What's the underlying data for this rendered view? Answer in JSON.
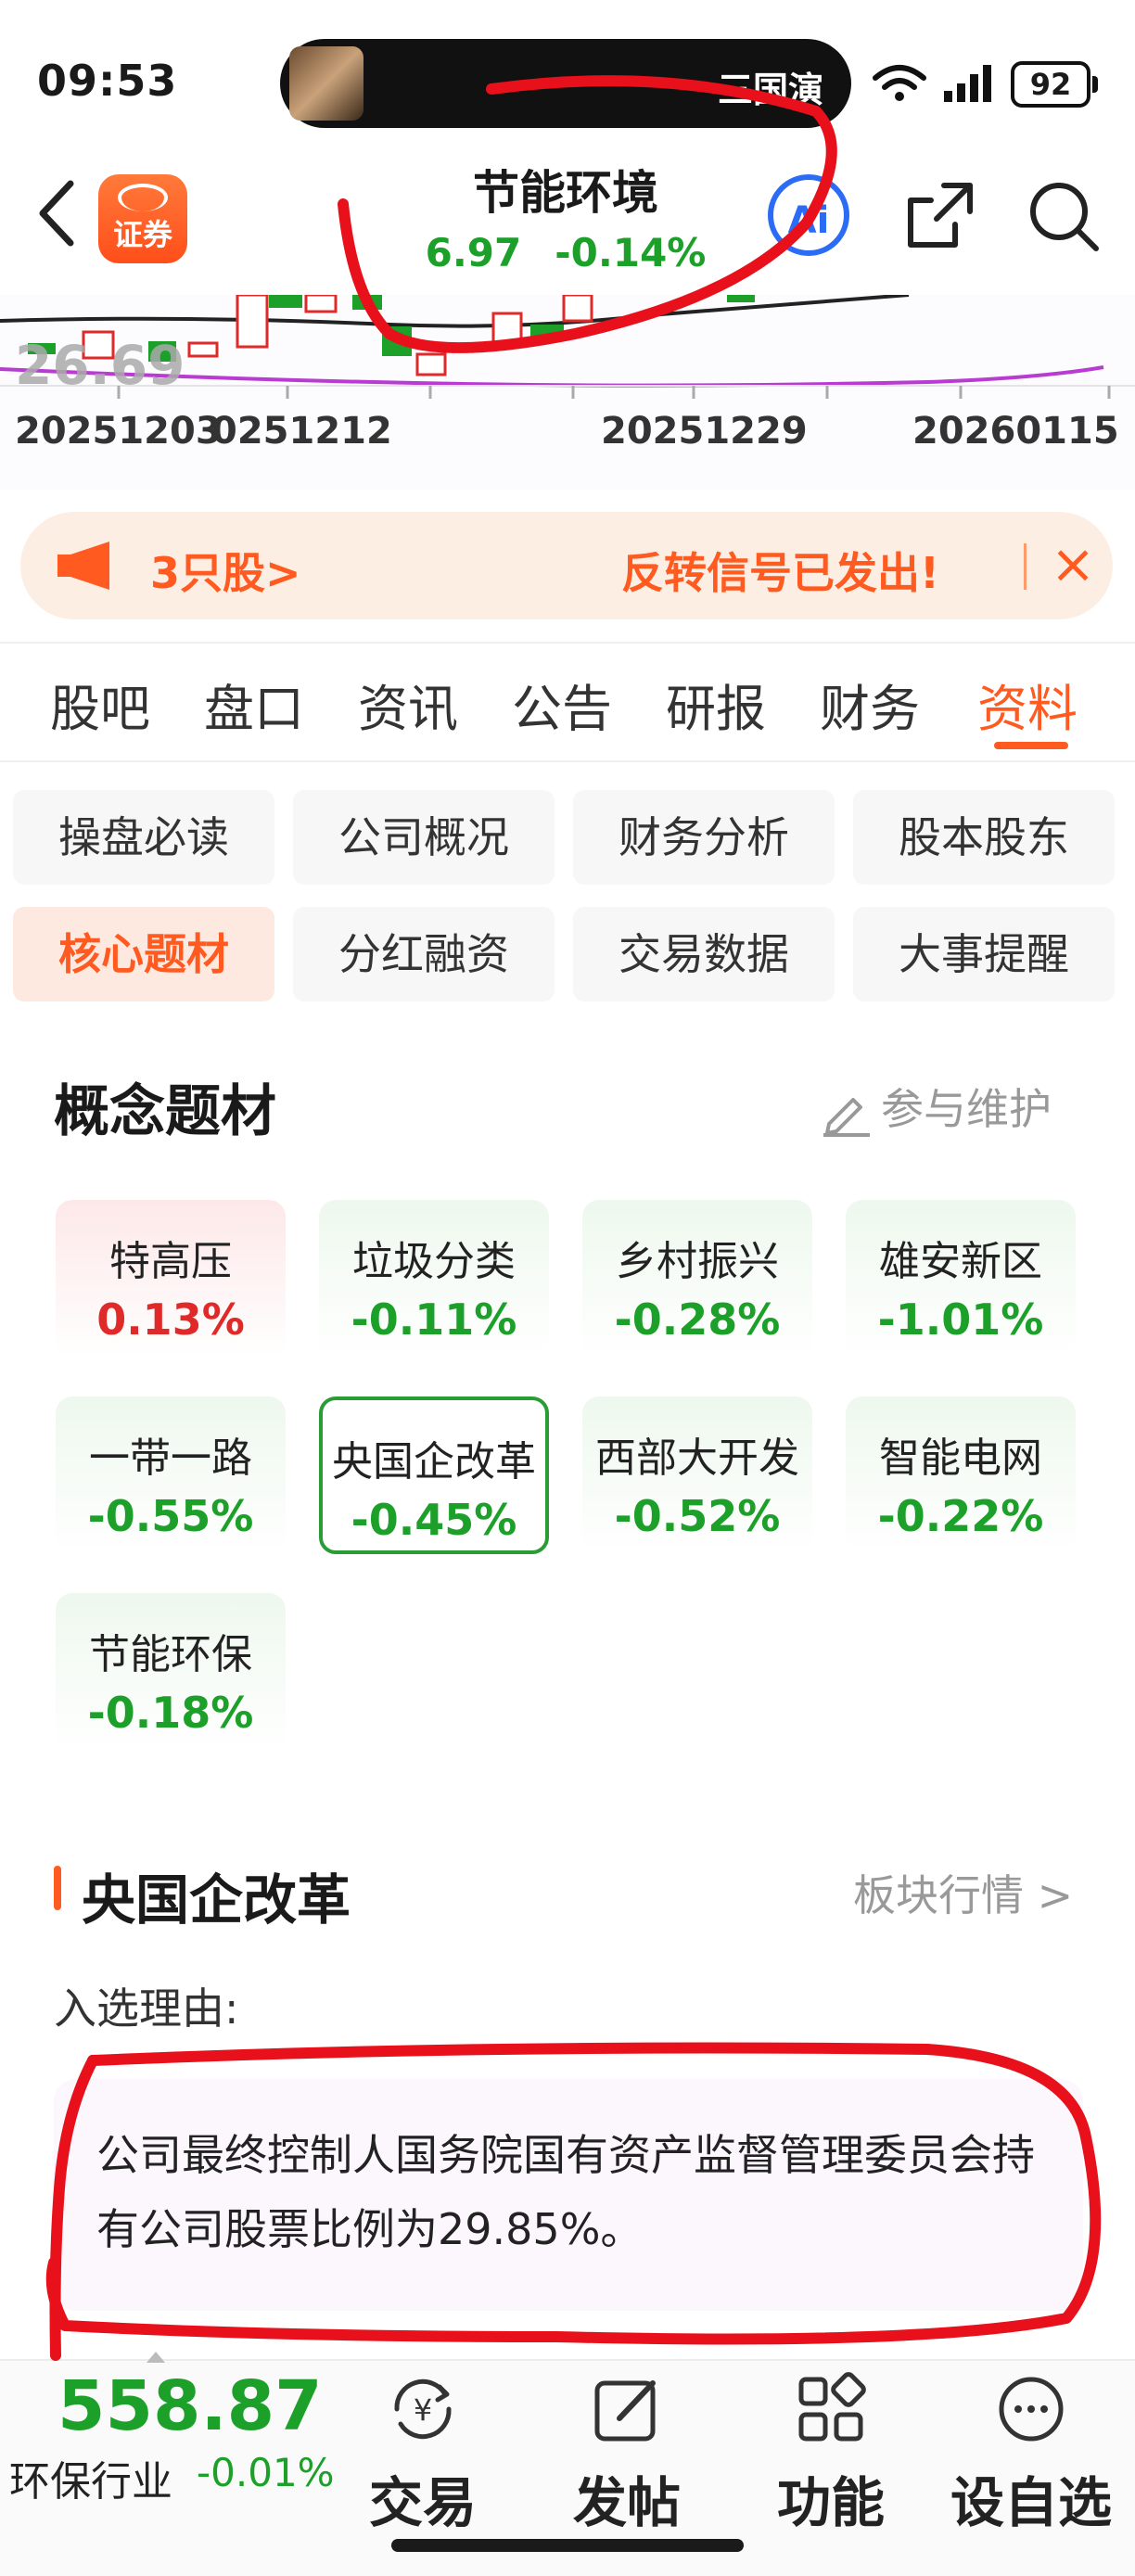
{
  "status_bar": {
    "time": "09:53",
    "live_activity_text": "三国演",
    "battery": "92"
  },
  "header": {
    "broker_logo_text": "证券",
    "stock_name": "节能环境",
    "price": "6.97",
    "change_pct": "-0.14%",
    "ai_label": "Ai"
  },
  "chart": {
    "overlay_value": "26.69",
    "dates": [
      "20251203",
      "0251212",
      "20251229",
      "20260115"
    ]
  },
  "banner": {
    "count_text": "3只股>",
    "message": "反转信号已发出!",
    "close_icon": "×"
  },
  "tabs": [
    {
      "label": "股吧"
    },
    {
      "label": "盘口"
    },
    {
      "label": "资讯"
    },
    {
      "label": "公告"
    },
    {
      "label": "研报"
    },
    {
      "label": "财务"
    },
    {
      "label": "资料",
      "active": true
    }
  ],
  "subnav": [
    {
      "label": "操盘必读"
    },
    {
      "label": "公司概况"
    },
    {
      "label": "财务分析"
    },
    {
      "label": "股本股东"
    },
    {
      "label": "核心题材",
      "active": true
    },
    {
      "label": "分红融资"
    },
    {
      "label": "交易数据"
    },
    {
      "label": "大事提醒"
    }
  ],
  "concepts": {
    "title": "概念题材",
    "maintain_label": "参与维护",
    "items": [
      {
        "name": "特高压",
        "change": "0.13%",
        "trend": "up"
      },
      {
        "name": "垃圾分类",
        "change": "-0.11%",
        "trend": "down"
      },
      {
        "name": "乡村振兴",
        "change": "-0.28%",
        "trend": "down"
      },
      {
        "name": "雄安新区",
        "change": "-1.01%",
        "trend": "down"
      },
      {
        "name": "一带一路",
        "change": "-0.55%",
        "trend": "down"
      },
      {
        "name": "央国企改革",
        "change": "-0.45%",
        "trend": "down",
        "selected": true
      },
      {
        "name": "西部大开发",
        "change": "-0.52%",
        "trend": "down"
      },
      {
        "name": "智能电网",
        "change": "-0.22%",
        "trend": "down"
      },
      {
        "name": "节能环保",
        "change": "-0.18%",
        "trend": "down"
      }
    ]
  },
  "detail": {
    "title": "央国企改革",
    "sector_link": "板块行情 >",
    "reason_label": "入选理由:",
    "reason_text": "公司最终控制人国务院国有资产监督管理委员会持有公司股票比例为29.85%。"
  },
  "bottom_bar": {
    "index_value": "558.87",
    "index_name": "环保行业",
    "index_change": "-0.01%",
    "items": [
      {
        "label": "交易",
        "icon": "yen-cycle-icon"
      },
      {
        "label": "发帖",
        "icon": "edit-icon"
      },
      {
        "label": "功能",
        "icon": "grid-icon"
      },
      {
        "label": "设自选",
        "icon": "more-icon"
      }
    ]
  },
  "colors": {
    "accent": "#ff5a1f",
    "down": "#1ca02a",
    "up": "#e02a2a",
    "annotation": "#e8101a"
  }
}
